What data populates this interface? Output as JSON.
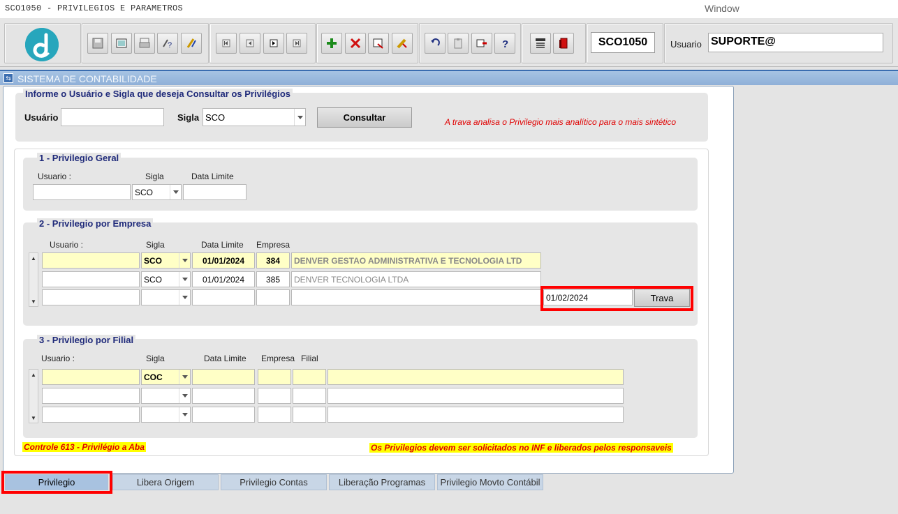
{
  "app": {
    "title": "SCO1050 - PRIVILEGIOS E PARAMETROS",
    "window_menu": "Window"
  },
  "toolbar": {
    "form_code": "SCO1050",
    "usuario_label": "Usuario",
    "usuario_value": "SUPORTE@"
  },
  "window": {
    "title": "SISTEMA DE CONTABILIDADE"
  },
  "consulta": {
    "title": "Informe o Usuário e Sigla que deseja Consultar os Privilégios",
    "usuario_label": "Usuário",
    "usuario_value": "",
    "sigla_label": "Sigla",
    "sigla_value": "SCO",
    "consultar_label": "Consultar",
    "note": "A trava analisa o Privilegio mais analítico para o mais sintético"
  },
  "geral": {
    "title": "1 - Privilegio Geral",
    "col_usuario": "Usuario :",
    "col_sigla": "Sigla",
    "col_data": "Data Limite",
    "usuario_value": "",
    "sigla_value": "SCO",
    "data_value": ""
  },
  "empresa": {
    "title": "2 - Privilegio por Empresa",
    "col_usuario": "Usuario :",
    "col_sigla": "Sigla",
    "col_data": "Data Limite",
    "col_empresa": "Empresa",
    "rows": [
      {
        "usuario": "",
        "sigla": "SCO",
        "data": "01/01/2024",
        "empresa": "384",
        "nome": "DENVER GESTAO ADMINISTRATIVA E TECNOLOGIA LTD"
      },
      {
        "usuario": "",
        "sigla": "SCO",
        "data": "01/01/2024",
        "empresa": "385",
        "nome": "DENVER TECNOLOGIA LTDA"
      },
      {
        "usuario": "",
        "sigla": "",
        "data": "",
        "empresa": "",
        "nome": ""
      }
    ],
    "trava_date": "01/02/2024",
    "trava_label": "Trava"
  },
  "filial": {
    "title": "3 - Privilegio por Filial",
    "col_usuario": "Usuario :",
    "col_sigla": "Sigla",
    "col_data": "Data Limite",
    "col_empresa": "Empresa",
    "col_filial": "Filial",
    "rows": [
      {
        "usuario": "",
        "sigla": "COC",
        "data": "",
        "empresa": "",
        "filial": "",
        "nome": ""
      },
      {
        "usuario": "",
        "sigla": "",
        "data": "",
        "empresa": "",
        "filial": "",
        "nome": ""
      },
      {
        "usuario": "",
        "sigla": "",
        "data": "",
        "empresa": "",
        "filial": "",
        "nome": ""
      }
    ]
  },
  "footer": {
    "controle": "Controle 613 - Privilégio a Aba",
    "aviso": "Os Privilegios devem ser solicitados no INF e liberados pelos responsaveis"
  },
  "tabs": [
    {
      "label": "Privilegio"
    },
    {
      "label": "Libera Origem"
    },
    {
      "label": "Privilegio Contas"
    },
    {
      "label": "Liberação Programas"
    },
    {
      "label": "Privilegio Movto Contábil"
    }
  ],
  "colors": {
    "accent": "#27a6bc",
    "highlight": "#ff0000",
    "field_yellow": "#ffffc6",
    "frame_title": "#1f2a7a"
  }
}
